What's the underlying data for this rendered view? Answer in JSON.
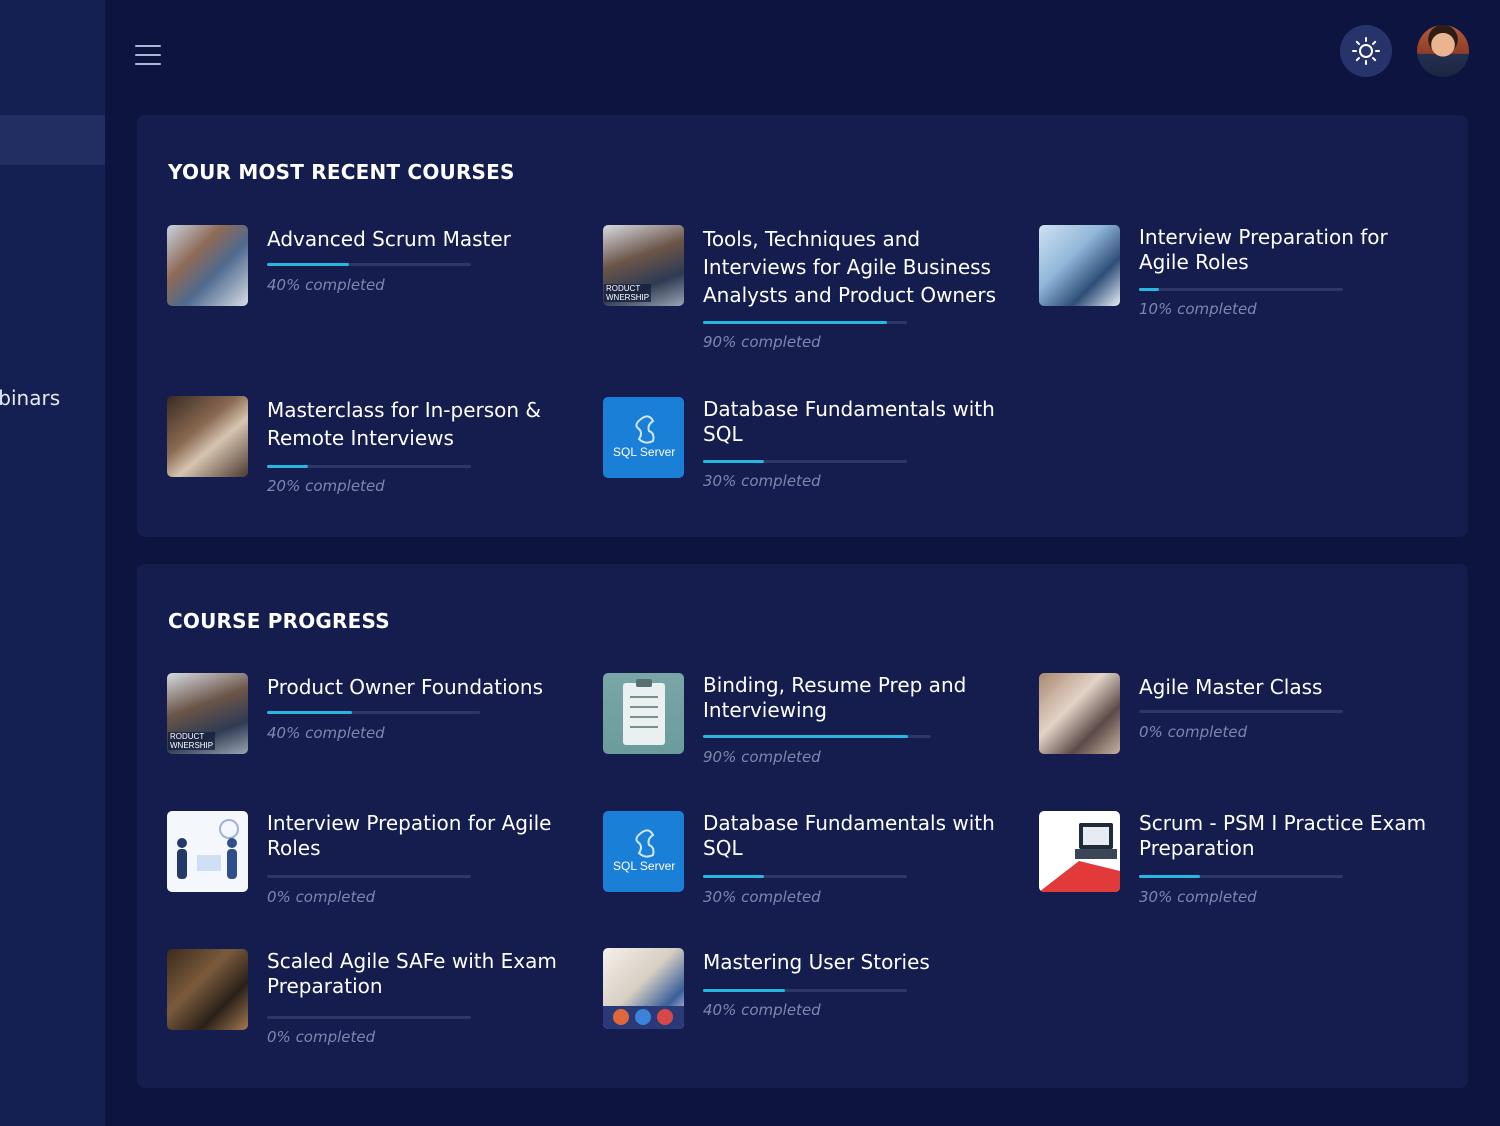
{
  "sidebar": {
    "item_label": "ebinars"
  },
  "header": {
    "menu_icon": "hamburger-menu-icon",
    "theme_icon": "sun-icon"
  },
  "recent": {
    "title": "YOUR MOST RECENT COURSES",
    "courses": [
      {
        "title": "Advanced Scrum Master",
        "progress": 0.4,
        "progress_label": "40% completed"
      },
      {
        "title": "Tools, Techniques and Interviews for Agile Business Analysts and Product Owners",
        "progress": 0.9,
        "progress_label": "90% completed",
        "badge": "RODUCT\nWNERSHIP"
      },
      {
        "title": "Interview Preparation for Agile Roles",
        "progress": 0.1,
        "progress_label": "10% completed"
      },
      {
        "title": "Masterclass for In-person & Remote Interviews",
        "progress": 0.2,
        "progress_label": "20% completed"
      },
      {
        "title": "Database Fundamentals with SQL",
        "progress": 0.3,
        "progress_label": "30% completed",
        "thumb_text": "SQL Server"
      }
    ]
  },
  "progress": {
    "title": "COURSE PROGRESS",
    "courses": [
      {
        "title": "Product Owner Foundations",
        "progress": 0.4,
        "progress_label": "40% completed",
        "badge": "RODUCT\nWNERSHIP"
      },
      {
        "title": "Binding, Resume Prep and Interviewing",
        "progress": 0.9,
        "progress_label": "90% completed"
      },
      {
        "title": "Agile Master Class",
        "progress": 0.0,
        "progress_label": "0% completed"
      },
      {
        "title": "Interview Prepation for Agile Roles",
        "progress": 0.0,
        "progress_label": "0% completed"
      },
      {
        "title": "Database Fundamentals with SQL",
        "progress": 0.3,
        "progress_label": "30% completed",
        "thumb_text": "SQL Server"
      },
      {
        "title": "Scrum - PSM I Practice Exam Preparation",
        "progress": 0.3,
        "progress_label": "30% completed"
      },
      {
        "title": "Scaled Agile SAFe with Exam Preparation",
        "progress": 0.0,
        "progress_label": "0% completed"
      },
      {
        "title": "Mastering User Stories",
        "progress": 0.4,
        "progress_label": "40% completed"
      }
    ]
  },
  "colors": {
    "accent": "#29b6e0",
    "panel": "#141d4e",
    "background": "#0e1440",
    "track": "#2c3766"
  }
}
